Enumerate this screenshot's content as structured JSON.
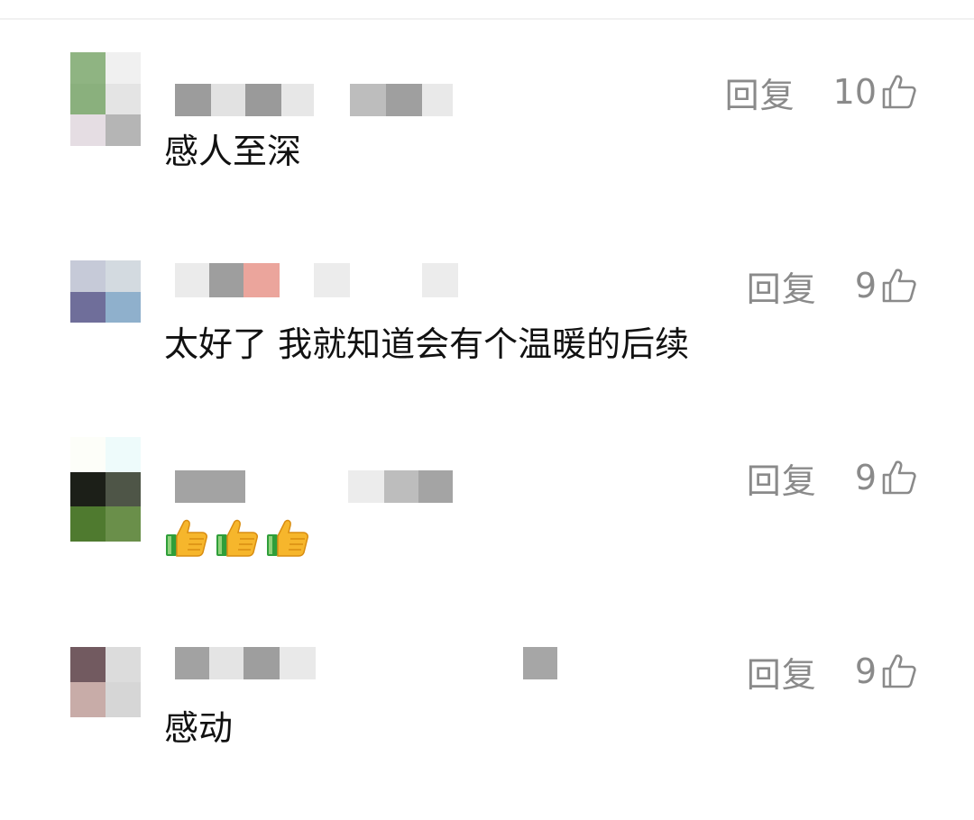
{
  "comments": [
    {
      "reply_label": "回复",
      "like_count": "10",
      "text": "感人至深"
    },
    {
      "reply_label": "回复",
      "like_count": "9",
      "text": "太好了 我就知道会有个温暖的后续"
    },
    {
      "reply_label": "回复",
      "like_count": "9",
      "text": "",
      "emojis": [
        "thumbs-up-emoji",
        "thumbs-up-emoji",
        "thumbs-up-emoji"
      ]
    },
    {
      "reply_label": "回复",
      "like_count": "9",
      "text": "感动"
    }
  ],
  "colors": {
    "meta_gray": "#8a8a8a",
    "text": "#111111",
    "background": "#ffffff"
  }
}
